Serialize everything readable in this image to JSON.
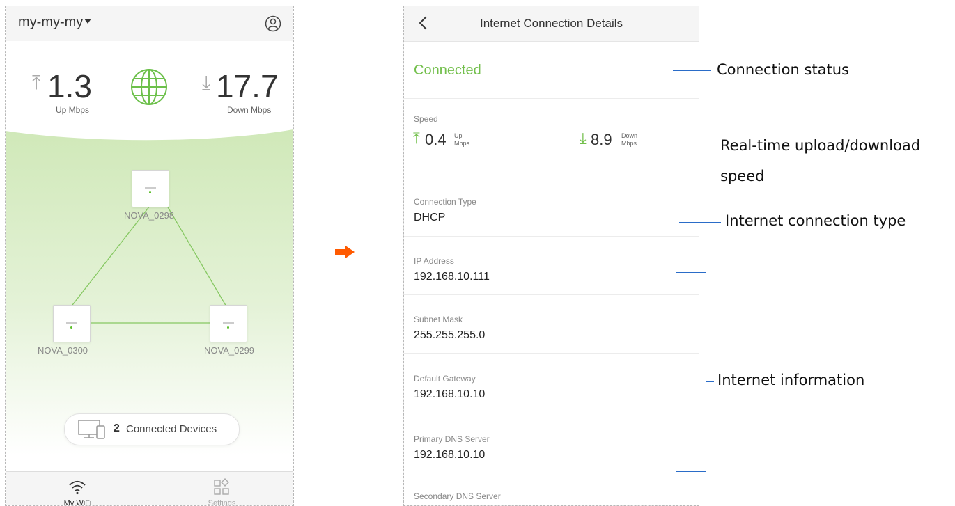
{
  "left_screen": {
    "network_name": "my-my-my",
    "up_speed": "1.3",
    "up_unit": "Up Mbps",
    "down_speed": "17.7",
    "down_unit": "Down Mbps",
    "nodes": [
      {
        "label": "NOVA_0298"
      },
      {
        "label": "NOVA_0300"
      },
      {
        "label": "NOVA_0299"
      }
    ],
    "connected_devices_count": "2",
    "connected_devices_label": "Connected Devices",
    "tabs": [
      {
        "label": "My WiFi",
        "active": true
      },
      {
        "label": "Settings",
        "active": false
      }
    ]
  },
  "right_screen": {
    "title": "Internet Connection Details",
    "status": "Connected",
    "speed_label": "Speed",
    "up_speed": "0.4",
    "up_unit_top": "Up",
    "up_unit_bottom": "Mbps",
    "down_speed": "8.9",
    "down_unit_top": "Down",
    "down_unit_bottom": "Mbps",
    "fields": [
      {
        "label": "Connection Type",
        "value": "DHCP"
      },
      {
        "label": "IP Address",
        "value": "192.168.10.111"
      },
      {
        "label": "Subnet Mask",
        "value": "255.255.255.0"
      },
      {
        "label": "Default Gateway",
        "value": "192.168.10.10"
      },
      {
        "label": "Primary DNS Server",
        "value": "192.168.10.10"
      },
      {
        "label": "Secondary DNS Server",
        "value": ""
      }
    ]
  },
  "annotations": {
    "connection_status": "Connection status",
    "realtime_speed_line1": "Real-time upload/download",
    "realtime_speed_line2": "speed",
    "connection_type": "Internet connection type",
    "internet_info": "Internet information"
  },
  "colors": {
    "accent_green": "#72bf4b",
    "annotation_blue": "#2a6cc8",
    "arrow_orange": "#ff5a00"
  }
}
